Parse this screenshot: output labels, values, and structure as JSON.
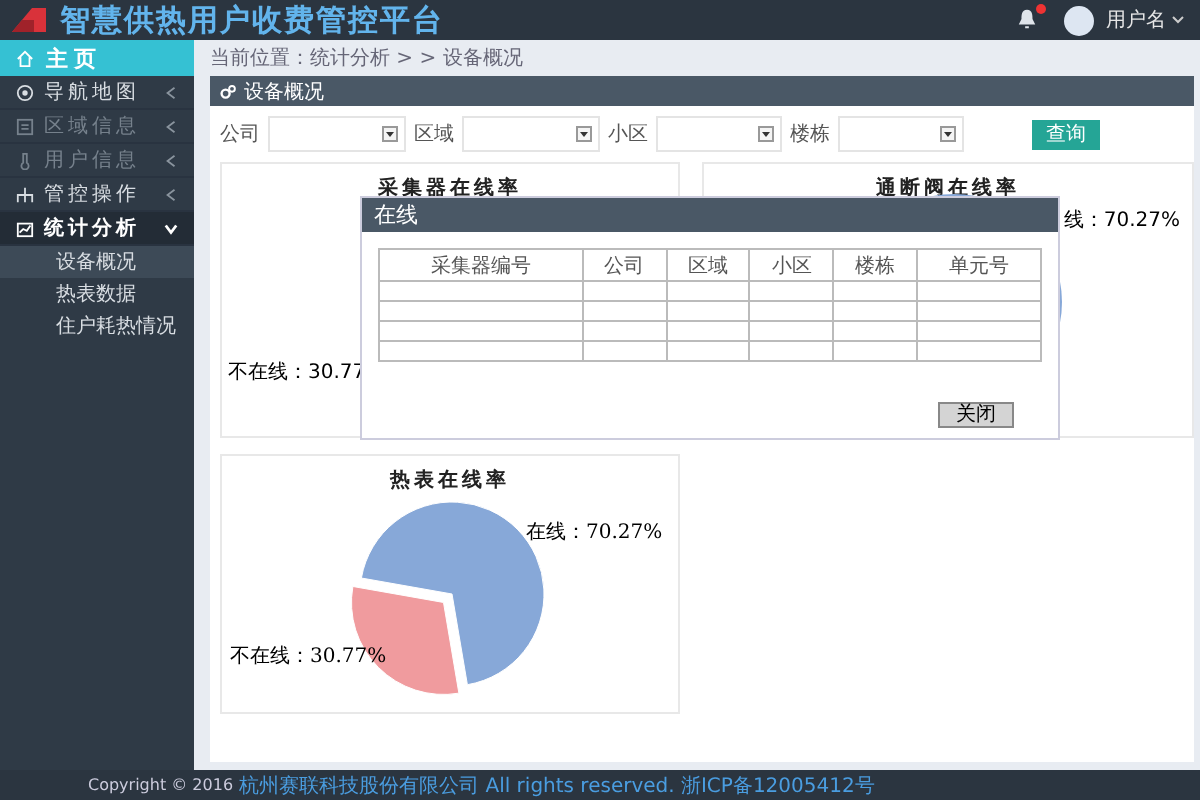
{
  "header": {
    "title": "智慧供热用户收费管控平台",
    "notification": true,
    "user": "用户名"
  },
  "sidebar": {
    "home": {
      "label": "主页",
      "selected": true
    },
    "items": [
      {
        "label": "导航地图",
        "kind": "compass",
        "disabled": false,
        "expanded": false
      },
      {
        "label": "区域信息",
        "kind": "grid",
        "disabled": true,
        "expanded": false
      },
      {
        "label": "用户信息",
        "kind": "thermo",
        "disabled": true,
        "expanded": false
      },
      {
        "label": "管控操作",
        "kind": "tree",
        "disabled": false,
        "expanded": false
      },
      {
        "label": "统计分析",
        "kind": "chart",
        "disabled": false,
        "expanded": true,
        "children": [
          {
            "label": "设备概况",
            "selected": true
          },
          {
            "label": "热表数据",
            "selected": false
          },
          {
            "label": "住户耗热情况",
            "selected": false
          }
        ]
      }
    ]
  },
  "breadcrumb": "当前位置：统计分析 > > 设备概况",
  "panel": {
    "title": "设备概况",
    "filters": [
      {
        "label": "公司"
      },
      {
        "label": "区域"
      },
      {
        "label": "小区"
      },
      {
        "label": "楼栋"
      }
    ],
    "query_button": "查询",
    "cards": [
      {
        "title": "采集器在线率",
        "label": "不在线：30.77"
      },
      {
        "title": "通断阀在线率",
        "label": "线：70.27%"
      },
      {
        "chart_data": {
          "type": "pie",
          "title": "热表在线率",
          "categories": [
            "在线：70.27%",
            "不在线：30.77%"
          ],
          "values": [
            70.27,
            30.77
          ]
        }
      }
    ]
  },
  "dialog": {
    "title": "在线",
    "columns": [
      "采集器编号",
      "公司",
      "区域",
      "小区",
      "楼栋",
      "单元号"
    ],
    "close_button": "关闭"
  },
  "footer": {
    "copyright": "Copyright © 2016",
    "link": "杭州赛联科技股份有限公司 All rights reserved. 浙ICP备12005412号"
  }
}
